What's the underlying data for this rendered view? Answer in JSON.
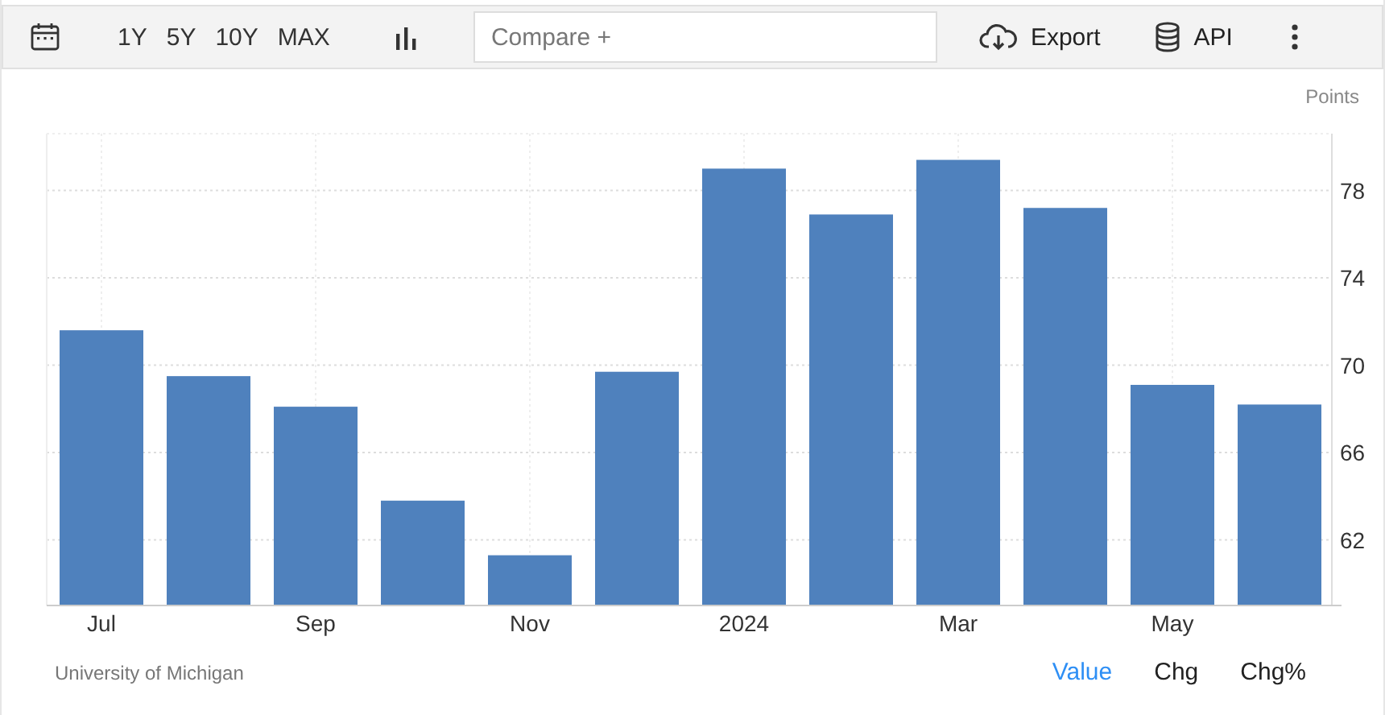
{
  "toolbar": {
    "ranges": [
      {
        "label": "1Y",
        "selected": false
      },
      {
        "label": "5Y",
        "selected": false
      },
      {
        "label": "10Y",
        "selected": false
      },
      {
        "label": "MAX",
        "selected": false
      }
    ],
    "compare": {
      "placeholder": "Compare +"
    },
    "export": "Export",
    "api": "API"
  },
  "chart": {
    "chart_data": {
      "type": "bar",
      "ylabel": "Points",
      "categories": [
        "Jul",
        null,
        "Sep",
        null,
        "Nov",
        null,
        "2024",
        null,
        "Mar",
        null,
        "May",
        null
      ],
      "values": [
        71.6,
        69.5,
        68.1,
        63.8,
        61.3,
        69.7,
        79.0,
        76.9,
        79.4,
        77.2,
        69.1,
        68.2
      ],
      "ylim": [
        59,
        80.6
      ],
      "yticks": [
        62,
        66,
        70,
        74,
        78
      ],
      "grid": true
    }
  },
  "footer": {
    "source": "University of Michigan",
    "modes": [
      {
        "label": "Value",
        "selected": true
      },
      {
        "label": "Chg",
        "selected": false
      },
      {
        "label": "Chg%",
        "selected": false
      }
    ]
  }
}
